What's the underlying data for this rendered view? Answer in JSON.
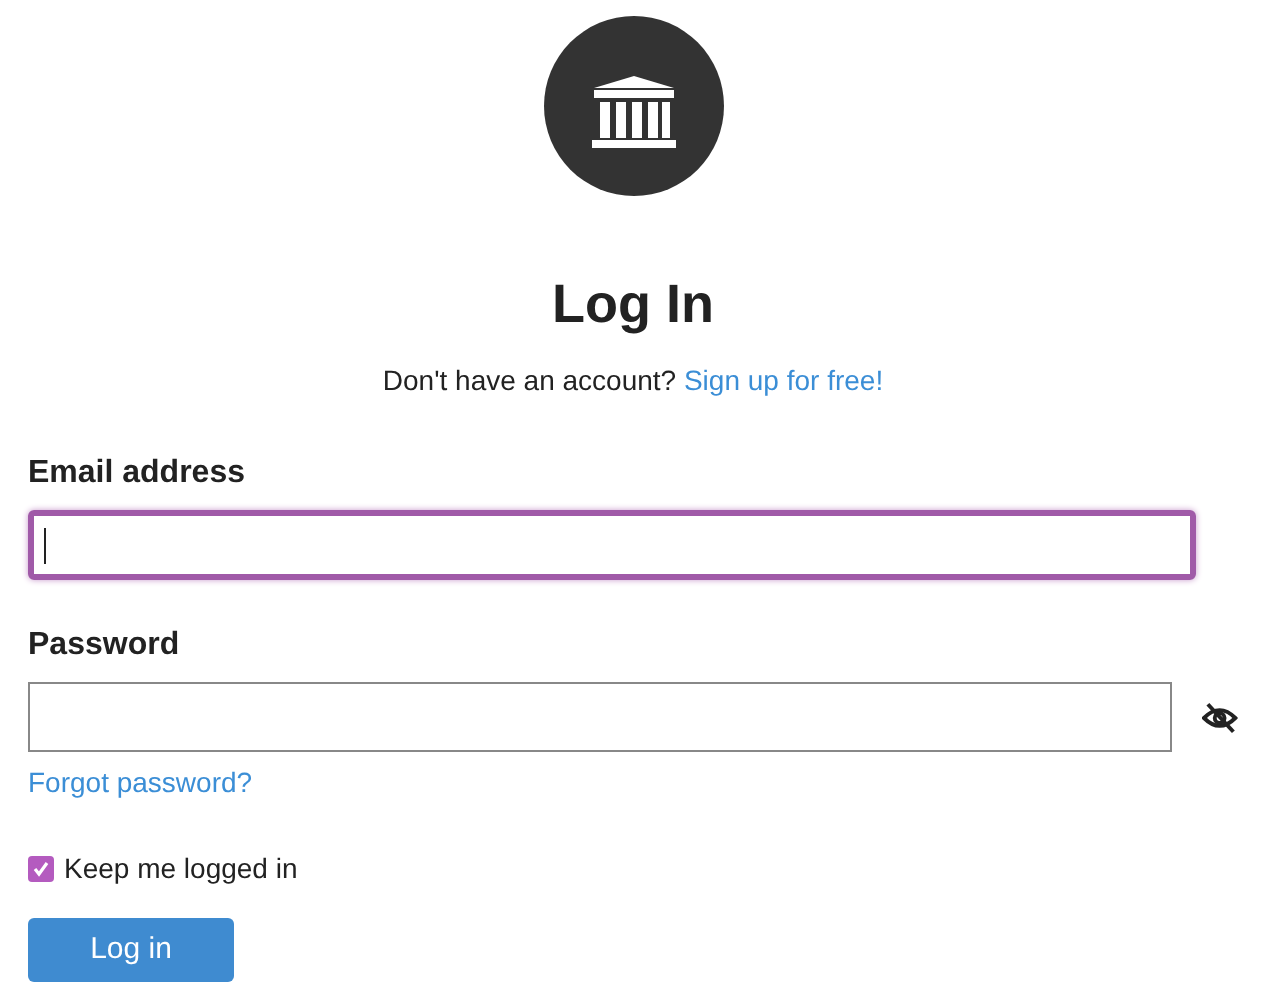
{
  "title": "Log In",
  "signup": {
    "prompt": "Don't have an account?",
    "link": "Sign up for free!"
  },
  "fields": [
    {
      "label": "Email address",
      "focused": true
    },
    {
      "label": "Password",
      "focused": false,
      "kind": "password"
    }
  ],
  "forgot_link": "Forgot password?",
  "remember": {
    "label": "Keep me logged in",
    "checked": true
  },
  "submit": "Log in"
}
